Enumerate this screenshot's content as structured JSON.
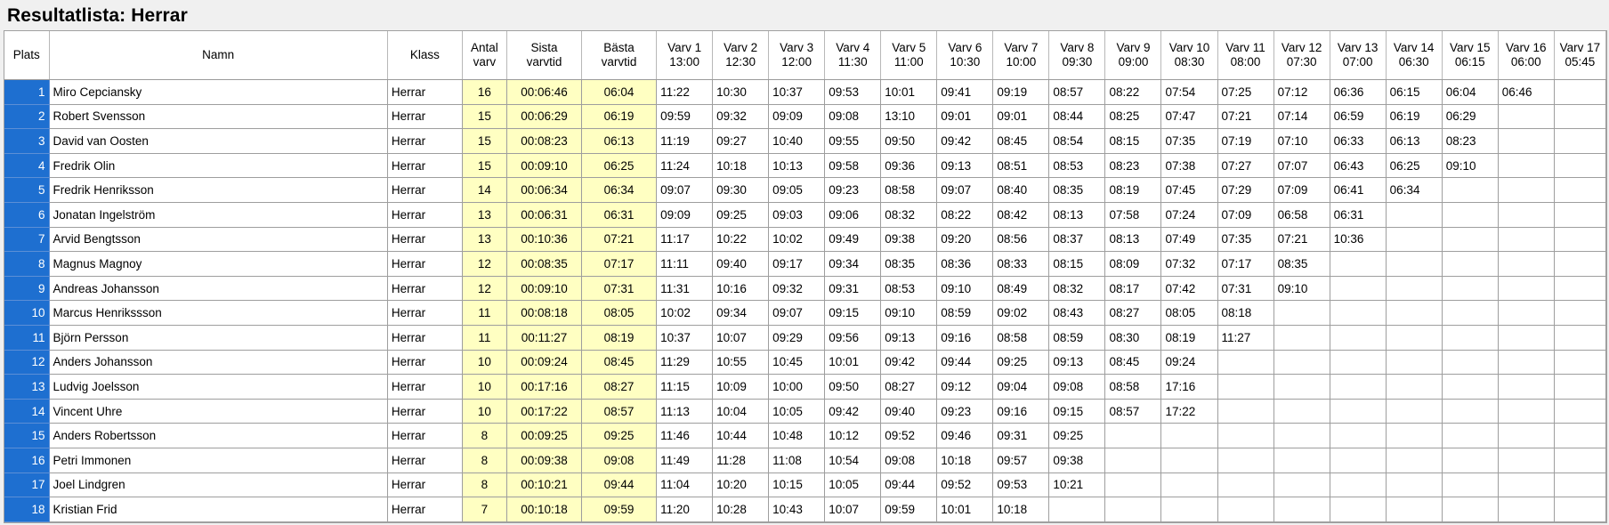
{
  "title": "Resultatlista: Herrar",
  "headers": {
    "plats": "Plats",
    "namn": "Namn",
    "klass": "Klass",
    "antal": [
      "Antal",
      "varv"
    ],
    "sista": [
      "Sista",
      "varvtid"
    ],
    "basta": [
      "Bästa",
      "varvtid"
    ],
    "laps": [
      [
        "Varv 1",
        "13:00"
      ],
      [
        "Varv 2",
        "12:30"
      ],
      [
        "Varv 3",
        "12:00"
      ],
      [
        "Varv 4",
        "11:30"
      ],
      [
        "Varv 5",
        "11:00"
      ],
      [
        "Varv 6",
        "10:30"
      ],
      [
        "Varv 7",
        "10:00"
      ],
      [
        "Varv 8",
        "09:30"
      ],
      [
        "Varv 9",
        "09:00"
      ],
      [
        "Varv 10",
        "08:30"
      ],
      [
        "Varv 11",
        "08:00"
      ],
      [
        "Varv 12",
        "07:30"
      ],
      [
        "Varv 13",
        "07:00"
      ],
      [
        "Varv 14",
        "06:30"
      ],
      [
        "Varv 15",
        "06:15"
      ],
      [
        "Varv 16",
        "06:00"
      ],
      [
        "Varv 17",
        "05:45"
      ]
    ]
  },
  "colors": {
    "plats_bg": "#1e6fd0",
    "highlight_bg": "#ffffc2"
  },
  "rows": [
    {
      "plats": "1",
      "namn": "Miro Cepciansky",
      "klass": "Herrar",
      "antal": "16",
      "sista": "00:06:46",
      "basta": "06:04",
      "laps": [
        "11:22",
        "10:30",
        "10:37",
        "09:53",
        "10:01",
        "09:41",
        "09:19",
        "08:57",
        "08:22",
        "07:54",
        "07:25",
        "07:12",
        "06:36",
        "06:15",
        "06:04",
        "06:46",
        ""
      ]
    },
    {
      "plats": "2",
      "namn": "Robert Svensson",
      "klass": "Herrar",
      "antal": "15",
      "sista": "00:06:29",
      "basta": "06:19",
      "laps": [
        "09:59",
        "09:32",
        "09:09",
        "09:08",
        "13:10",
        "09:01",
        "09:01",
        "08:44",
        "08:25",
        "07:47",
        "07:21",
        "07:14",
        "06:59",
        "06:19",
        "06:29",
        "",
        ""
      ]
    },
    {
      "plats": "3",
      "namn": "David van Oosten",
      "klass": "Herrar",
      "antal": "15",
      "sista": "00:08:23",
      "basta": "06:13",
      "laps": [
        "11:19",
        "09:27",
        "10:40",
        "09:55",
        "09:50",
        "09:42",
        "08:45",
        "08:54",
        "08:15",
        "07:35",
        "07:19",
        "07:10",
        "06:33",
        "06:13",
        "08:23",
        "",
        ""
      ]
    },
    {
      "plats": "4",
      "namn": "Fredrik  Olin",
      "klass": "Herrar",
      "antal": "15",
      "sista": "00:09:10",
      "basta": "06:25",
      "laps": [
        "11:24",
        "10:18",
        "10:13",
        "09:58",
        "09:36",
        "09:13",
        "08:51",
        "08:53",
        "08:23",
        "07:38",
        "07:27",
        "07:07",
        "06:43",
        "06:25",
        "09:10",
        "",
        ""
      ]
    },
    {
      "plats": "5",
      "namn": "Fredrik  Henriksson",
      "klass": "Herrar",
      "antal": "14",
      "sista": "00:06:34",
      "basta": "06:34",
      "laps": [
        "09:07",
        "09:30",
        "09:05",
        "09:23",
        "08:58",
        "09:07",
        "08:40",
        "08:35",
        "08:19",
        "07:45",
        "07:29",
        "07:09",
        "06:41",
        "06:34",
        "",
        "",
        ""
      ]
    },
    {
      "plats": "6",
      "namn": "Jonatan Ingelström",
      "klass": "Herrar",
      "antal": "13",
      "sista": "00:06:31",
      "basta": "06:31",
      "laps": [
        "09:09",
        "09:25",
        "09:03",
        "09:06",
        "08:32",
        "08:22",
        "08:42",
        "08:13",
        "07:58",
        "07:24",
        "07:09",
        "06:58",
        "06:31",
        "",
        "",
        "",
        ""
      ]
    },
    {
      "plats": "7",
      "namn": "Arvid Bengtsson",
      "klass": "Herrar",
      "antal": "13",
      "sista": "00:10:36",
      "basta": "07:21",
      "laps": [
        "11:17",
        "10:22",
        "10:02",
        "09:49",
        "09:38",
        "09:20",
        "08:56",
        "08:37",
        "08:13",
        "07:49",
        "07:35",
        "07:21",
        "10:36",
        "",
        "",
        "",
        ""
      ]
    },
    {
      "plats": "8",
      "namn": "Magnus Magnoy",
      "klass": "Herrar",
      "antal": "12",
      "sista": "00:08:35",
      "basta": "07:17",
      "laps": [
        "11:11",
        "09:40",
        "09:17",
        "09:34",
        "08:35",
        "08:36",
        "08:33",
        "08:15",
        "08:09",
        "07:32",
        "07:17",
        "08:35",
        "",
        "",
        "",
        "",
        ""
      ]
    },
    {
      "plats": "9",
      "namn": "Andreas Johansson",
      "klass": "Herrar",
      "antal": "12",
      "sista": "00:09:10",
      "basta": "07:31",
      "laps": [
        "11:31",
        "10:16",
        "09:32",
        "09:31",
        "08:53",
        "09:10",
        "08:49",
        "08:32",
        "08:17",
        "07:42",
        "07:31",
        "09:10",
        "",
        "",
        "",
        "",
        ""
      ]
    },
    {
      "plats": "10",
      "namn": "Marcus  Henrikssson",
      "klass": "Herrar",
      "antal": "11",
      "sista": "00:08:18",
      "basta": "08:05",
      "laps": [
        "10:02",
        "09:34",
        "09:07",
        "09:15",
        "09:10",
        "08:59",
        "09:02",
        "08:43",
        "08:27",
        "08:05",
        "08:18",
        "",
        "",
        "",
        "",
        "",
        ""
      ]
    },
    {
      "plats": "11",
      "namn": "Björn Persson",
      "klass": "Herrar",
      "antal": "11",
      "sista": "00:11:27",
      "basta": "08:19",
      "laps": [
        "10:37",
        "10:07",
        "09:29",
        "09:56",
        "09:13",
        "09:16",
        "08:58",
        "08:59",
        "08:30",
        "08:19",
        "11:27",
        "",
        "",
        "",
        "",
        "",
        ""
      ]
    },
    {
      "plats": "12",
      "namn": "Anders Johansson",
      "klass": "Herrar",
      "antal": "10",
      "sista": "00:09:24",
      "basta": "08:45",
      "laps": [
        "11:29",
        "10:55",
        "10:45",
        "10:01",
        "09:42",
        "09:44",
        "09:25",
        "09:13",
        "08:45",
        "09:24",
        "",
        "",
        "",
        "",
        "",
        "",
        ""
      ]
    },
    {
      "plats": "13",
      "namn": "Ludvig  Joelsson",
      "klass": "Herrar",
      "antal": "10",
      "sista": "00:17:16",
      "basta": "08:27",
      "laps": [
        "11:15",
        "10:09",
        "10:00",
        "09:50",
        "08:27",
        "09:12",
        "09:04",
        "09:08",
        "08:58",
        "17:16",
        "",
        "",
        "",
        "",
        "",
        "",
        ""
      ]
    },
    {
      "plats": "14",
      "namn": "Vincent Uhre",
      "klass": "Herrar",
      "antal": "10",
      "sista": "00:17:22",
      "basta": "08:57",
      "laps": [
        "11:13",
        "10:04",
        "10:05",
        "09:42",
        "09:40",
        "09:23",
        "09:16",
        "09:15",
        "08:57",
        "17:22",
        "",
        "",
        "",
        "",
        "",
        "",
        ""
      ]
    },
    {
      "plats": "15",
      "namn": "Anders Robertsson",
      "klass": "Herrar",
      "antal": "8",
      "sista": "00:09:25",
      "basta": "09:25",
      "laps": [
        "11:46",
        "10:44",
        "10:48",
        "10:12",
        "09:52",
        "09:46",
        "09:31",
        "09:25",
        "",
        "",
        "",
        "",
        "",
        "",
        "",
        "",
        ""
      ]
    },
    {
      "plats": "16",
      "namn": "Petri Immonen",
      "klass": "Herrar",
      "antal": "8",
      "sista": "00:09:38",
      "basta": "09:08",
      "laps": [
        "11:49",
        "11:28",
        "11:08",
        "10:54",
        "09:08",
        "10:18",
        "09:57",
        "09:38",
        "",
        "",
        "",
        "",
        "",
        "",
        "",
        "",
        ""
      ]
    },
    {
      "plats": "17",
      "namn": "Joel  Lindgren",
      "klass": "Herrar",
      "antal": "8",
      "sista": "00:10:21",
      "basta": "09:44",
      "laps": [
        "11:04",
        "10:20",
        "10:15",
        "10:05",
        "09:44",
        "09:52",
        "09:53",
        "10:21",
        "",
        "",
        "",
        "",
        "",
        "",
        "",
        "",
        ""
      ]
    },
    {
      "plats": "18",
      "namn": "Kristian Frid",
      "klass": "Herrar",
      "antal": "7",
      "sista": "00:10:18",
      "basta": "09:59",
      "laps": [
        "11:20",
        "10:28",
        "10:43",
        "10:07",
        "09:59",
        "10:01",
        "10:18",
        "",
        "",
        "",
        "",
        "",
        "",
        "",
        "",
        "",
        ""
      ]
    }
  ]
}
